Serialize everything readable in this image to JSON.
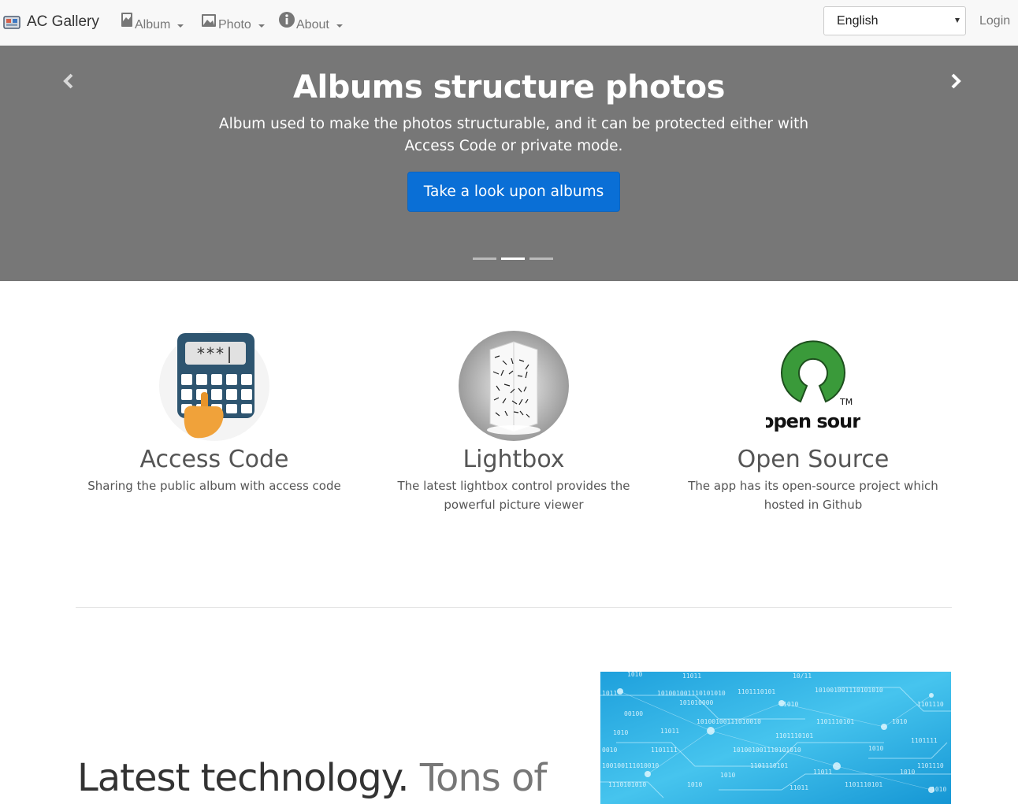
{
  "navbar": {
    "brand": "AC Gallery",
    "items": [
      {
        "label": "Album",
        "icon": "album-icon"
      },
      {
        "label": "Photo",
        "icon": "image-icon"
      },
      {
        "label": "About",
        "icon": "info-icon"
      }
    ],
    "language": "English",
    "login": "Login"
  },
  "carousel": {
    "title": "Albums structure photos",
    "text": "Album used to make the photos structurable, and it can be protected either with Access Code or private mode.",
    "button": "Take a look upon albums",
    "slide_count": 3,
    "active_slide": 2
  },
  "features": [
    {
      "title": "Access Code",
      "desc": "Sharing the public album with access code",
      "image": "keypad-image",
      "image_text": "***|"
    },
    {
      "title": "Lightbox",
      "desc": "The latest lightbox control provides the powerful picture viewer",
      "image": "lightbox-image"
    },
    {
      "title": "Open Source",
      "desc": "The app has its open-source project which hosted in Github",
      "image": "open-source-logo",
      "image_text": "open source",
      "tm": "TM"
    }
  ],
  "section": {
    "heading_main": "Latest technology.",
    "heading_muted": "Tons of"
  },
  "colors": {
    "navbar_bg": "#f8f8f8",
    "carousel_bg": "#777777",
    "primary_button": "#0a6fd6",
    "osi_green": "#3a9a3a"
  }
}
